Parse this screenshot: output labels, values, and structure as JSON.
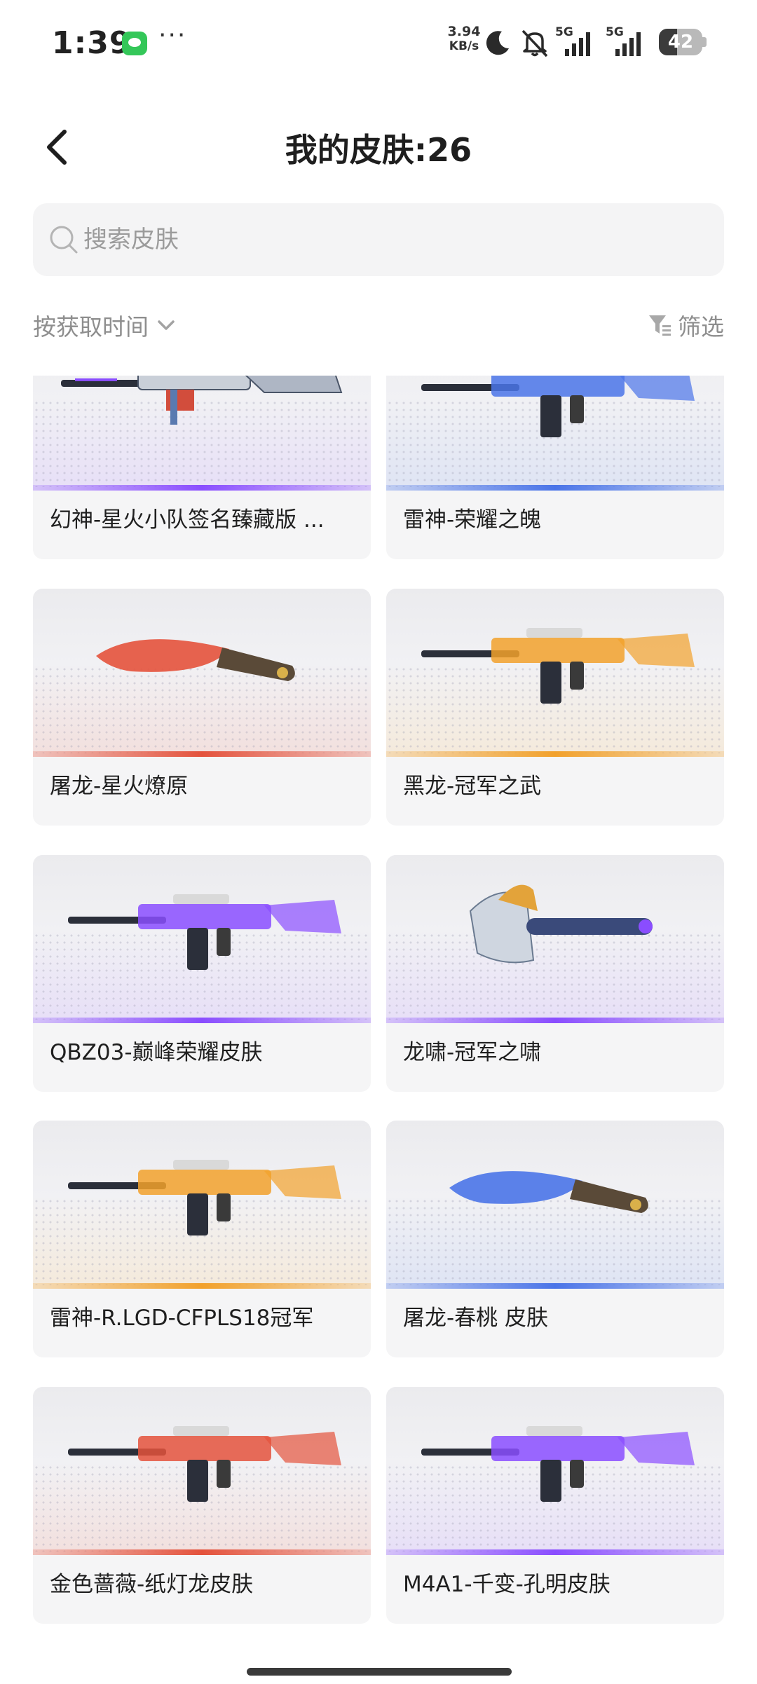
{
  "status_bar": {
    "time": "1:39",
    "net_speed_value": "3.94",
    "net_speed_unit": "KB/s",
    "signal_1_label": "5G",
    "signal_2_label": "5G",
    "battery_level": "42"
  },
  "header": {
    "title": "我的皮肤:26"
  },
  "search": {
    "placeholder": "搜索皮肤"
  },
  "controls": {
    "sort_label": "按获取时间",
    "filter_label": "筛选"
  },
  "skins": [
    {
      "name": "幻神-星火小队签名臻藏版 ...",
      "rarity_color": "#8a4dff",
      "icon": "sniper-rifle-icon"
    },
    {
      "name": "雷神-荣耀之魄",
      "rarity_color": "#4a74e8",
      "icon": "assault-rifle-icon"
    },
    {
      "name": "屠龙-星火燎原",
      "rarity_color": "#e4523c",
      "icon": "machete-icon"
    },
    {
      "name": "黑龙-冠军之武",
      "rarity_color": "#f2a12b",
      "icon": "assault-rifle-icon"
    },
    {
      "name": "QBZ03-巅峰荣耀皮肤",
      "rarity_color": "#8a4dff",
      "icon": "assault-rifle-icon"
    },
    {
      "name": "龙啸-冠军之啸",
      "rarity_color": "#8a4dff",
      "icon": "axe-icon"
    },
    {
      "name": "雷神-R.LGD-CFPLS18冠军",
      "rarity_color": "#f2a12b",
      "icon": "assault-rifle-icon"
    },
    {
      "name": "屠龙-春桃 皮肤",
      "rarity_color": "#4a74e8",
      "icon": "machete-icon"
    },
    {
      "name": "金色蔷薇-纸灯龙皮肤",
      "rarity_color": "#e4523c",
      "icon": "assault-rifle-icon"
    },
    {
      "name": "M4A1-千变-孔明皮肤",
      "rarity_color": "#8a4dff",
      "icon": "assault-rifle-icon"
    }
  ]
}
